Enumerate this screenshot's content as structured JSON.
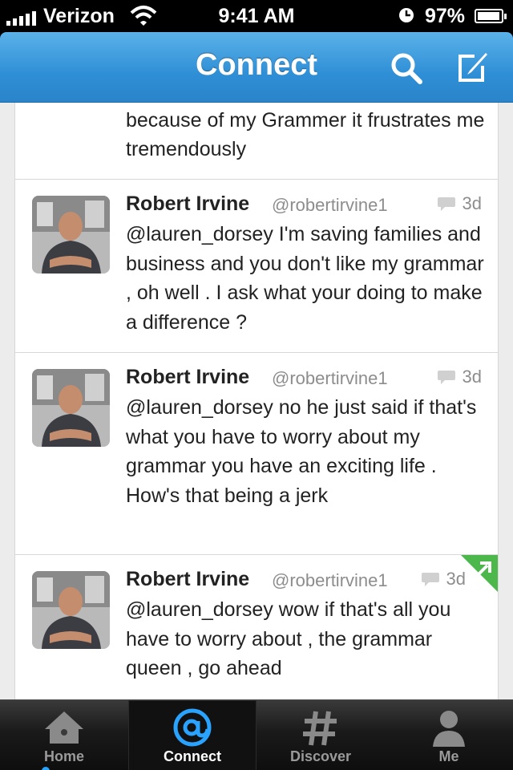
{
  "status_bar": {
    "carrier": "Verizon",
    "time": "9:41 AM",
    "battery_percent": "97%",
    "battery_level": 0.97
  },
  "nav": {
    "title": "Connect",
    "search_icon": "search-icon",
    "compose_icon": "compose-icon",
    "accent_color": "#2f8fd6"
  },
  "timeline": {
    "partial_tweet": {
      "text": "because of my Grammer it frustrates me tremendously"
    },
    "tweets": [
      {
        "name": "Robert Irvine",
        "handle": "@robertirvine1",
        "time": "3d",
        "text": "@lauren_dorsey I'm saving families and business and you don't like my grammar , oh well . I ask what your doing to make a difference ?"
      },
      {
        "name": "Robert Irvine",
        "handle": "@robertirvine1",
        "time": "3d",
        "text": "@lauren_dorsey no he just said if that's what you have to worry about my grammar you have an exciting life . How's that being a jerk"
      },
      {
        "name": "Robert Irvine",
        "handle": "@robertirvine1",
        "time": "3d",
        "text": "@lauren_dorsey wow if that's all you have to worry about , the grammar queen , go ahead"
      }
    ]
  },
  "tabs": [
    {
      "label": "Home",
      "icon": "home-icon"
    },
    {
      "label": "Connect",
      "icon": "at-sign-icon",
      "active": true
    },
    {
      "label": "Discover",
      "icon": "hashtag-icon"
    },
    {
      "label": "Me",
      "icon": "person-icon"
    }
  ]
}
